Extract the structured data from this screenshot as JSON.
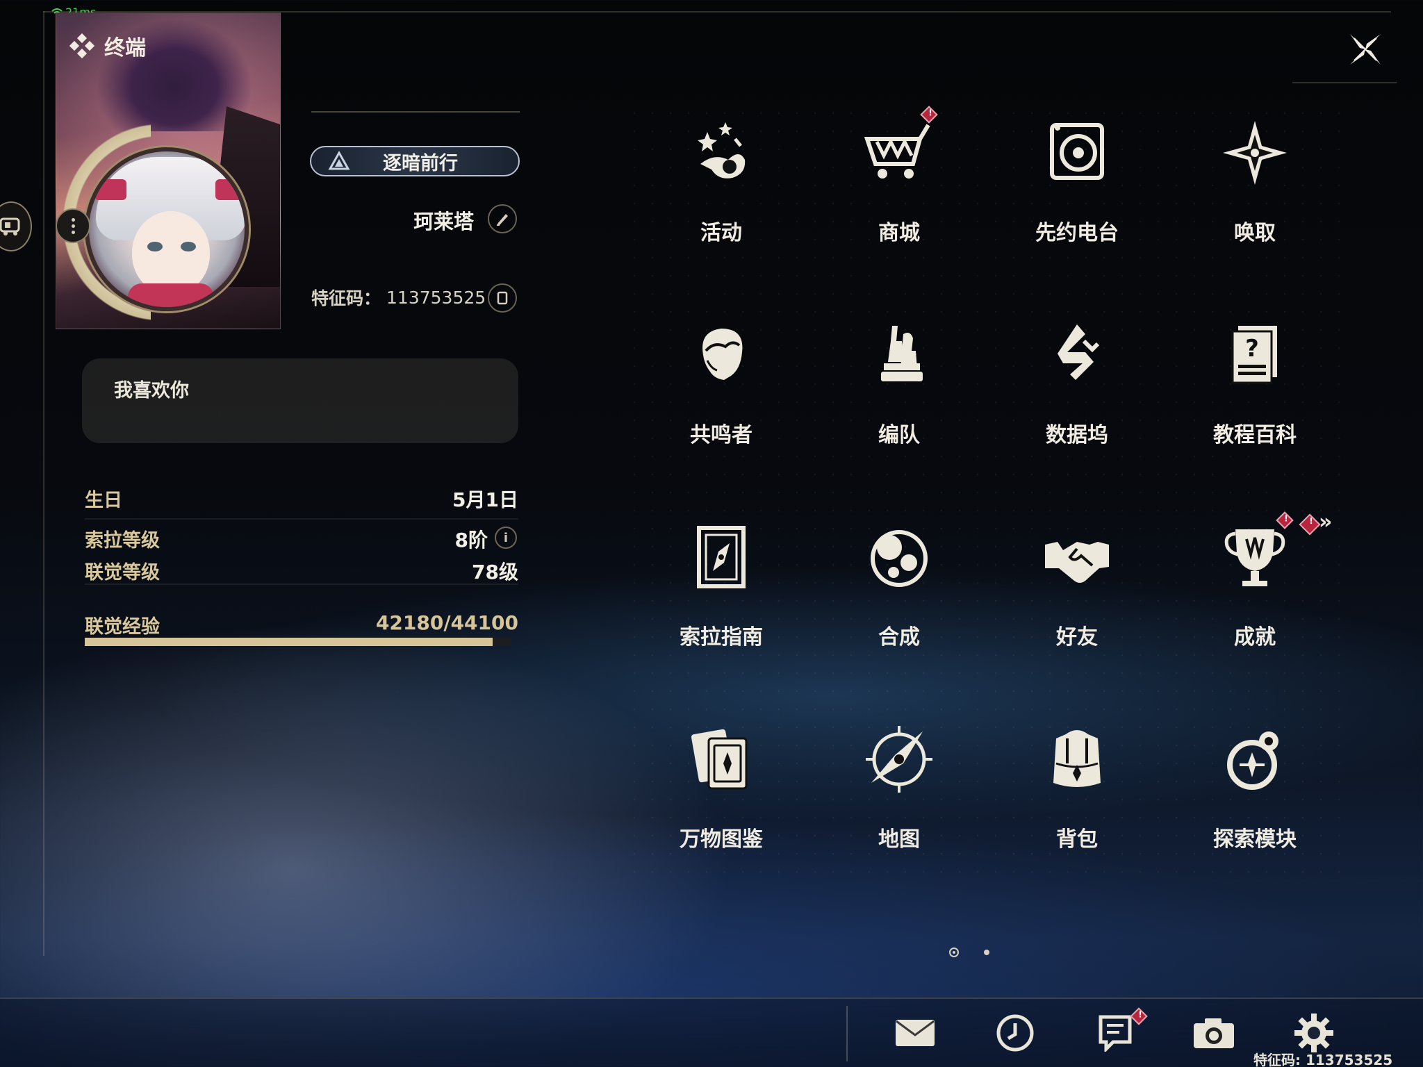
{
  "status": {
    "ping": "21ms"
  },
  "app": {
    "title": "终端"
  },
  "profile": {
    "title_badge": "逐暗前行",
    "name": "珂莱塔",
    "uid_label": "特征码：",
    "uid": "113753525",
    "signature": "我喜欢你",
    "stats": {
      "birthday_label": "生日",
      "birthday_value": "5月1日",
      "sola_level_label": "索拉等级",
      "sola_level_value": "8阶",
      "union_level_label": "联觉等级",
      "union_level_value": "78级",
      "union_exp_label": "联觉经验",
      "union_exp_value": "42180/44100",
      "union_exp_current": 42180,
      "union_exp_max": 44100
    }
  },
  "menu": [
    {
      "label": "活动",
      "icon": "event-stars-icon"
    },
    {
      "label": "商城",
      "icon": "shop-cart-icon"
    },
    {
      "label": "先约电台",
      "icon": "radio-icon"
    },
    {
      "label": "唤取",
      "icon": "convene-star-icon"
    },
    {
      "label": "共鸣者",
      "icon": "resonator-head-icon"
    },
    {
      "label": "编队",
      "icon": "team-chess-icon"
    },
    {
      "label": "数据坞",
      "icon": "data-bank-icon"
    },
    {
      "label": "教程百科",
      "icon": "tutorial-doc-icon"
    },
    {
      "label": "索拉指南",
      "icon": "guide-book-icon"
    },
    {
      "label": "合成",
      "icon": "synthesis-icon"
    },
    {
      "label": "好友",
      "icon": "handshake-icon"
    },
    {
      "label": "成就",
      "icon": "trophy-icon"
    },
    {
      "label": "万物图鉴",
      "icon": "archive-cards-icon"
    },
    {
      "label": "地图",
      "icon": "compass-map-icon"
    },
    {
      "label": "背包",
      "icon": "backpack-icon"
    },
    {
      "label": "探索模块",
      "icon": "explore-module-icon"
    }
  ],
  "bottom": {
    "uid_text": "特征码: 113753525",
    "buttons": [
      "mail-icon",
      "clock-icon",
      "notice-icon",
      "camera-icon",
      "settings-gear-icon"
    ]
  },
  "colors": {
    "accent": "#d6c599",
    "alert": "#b8263e"
  }
}
